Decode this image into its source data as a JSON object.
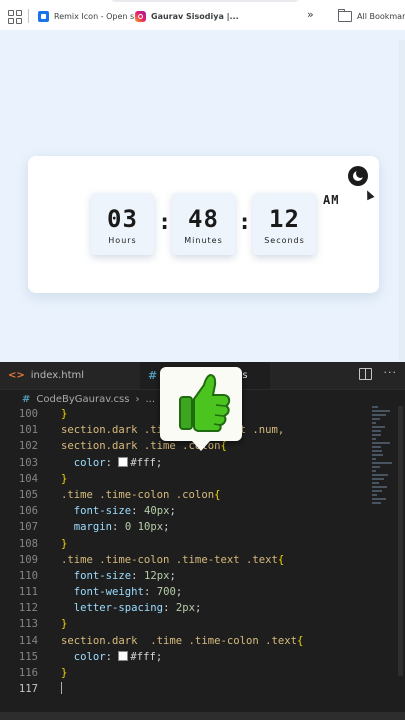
{
  "browser": {
    "bookmarks": [
      {
        "label": "Remix Icon - Open s...",
        "icon": "remix-favicon"
      },
      {
        "label": "Gaurav Sisodiya |...",
        "icon": "instagram-favicon"
      }
    ],
    "more_label": "»",
    "all_bookmarks_label": "All Bookmarks"
  },
  "clock": {
    "hours": "03",
    "hours_label": "Hours",
    "minutes": "48",
    "minutes_label": "Minutes",
    "seconds": "12",
    "seconds_label": "Seconds",
    "separator": ":",
    "ampm": "AM",
    "toggle_icon": "moon-icon"
  },
  "editor": {
    "tabs": [
      {
        "label": "index.html",
        "icon": "<>"
      },
      {
        "label": "ss",
        "icon": "#"
      }
    ],
    "breadcrumb": {
      "file": "CodeByGaurav.css",
      "rest": "..."
    },
    "lines": [
      {
        "n": "100",
        "code": "}"
      },
      {
        "n": "101",
        "code": "section.dark .time .time-text .num,"
      },
      {
        "n": "102",
        "code": "section.dark .time .colon{"
      },
      {
        "n": "103",
        "code": "  color: #fff;"
      },
      {
        "n": "104",
        "code": "}"
      },
      {
        "n": "105",
        "code": ".time .time-colon .colon{"
      },
      {
        "n": "106",
        "code": "  font-size: 40px;"
      },
      {
        "n": "107",
        "code": "  margin: 0 10px;"
      },
      {
        "n": "108",
        "code": "}"
      },
      {
        "n": "109",
        "code": ".time .time-colon .time-text .text{"
      },
      {
        "n": "110",
        "code": "  font-size: 12px;"
      },
      {
        "n": "111",
        "code": "  font-weight: 700;"
      },
      {
        "n": "112",
        "code": "  letter-spacing: 2px;"
      },
      {
        "n": "113",
        "code": "}"
      },
      {
        "n": "114",
        "code": "section.dark  .time .time-colon .text{"
      },
      {
        "n": "115",
        "code": "  color: #fff;"
      },
      {
        "n": "116",
        "code": "}"
      },
      {
        "n": "117",
        "code": ""
      }
    ]
  },
  "colors": {
    "page_bg": "#eaf3fd",
    "editor_bg": "#1e1e1e",
    "selector": "#d7ba7d",
    "property": "#9cdcfe",
    "value": "#b5cea8",
    "brace": "#f1d700"
  }
}
